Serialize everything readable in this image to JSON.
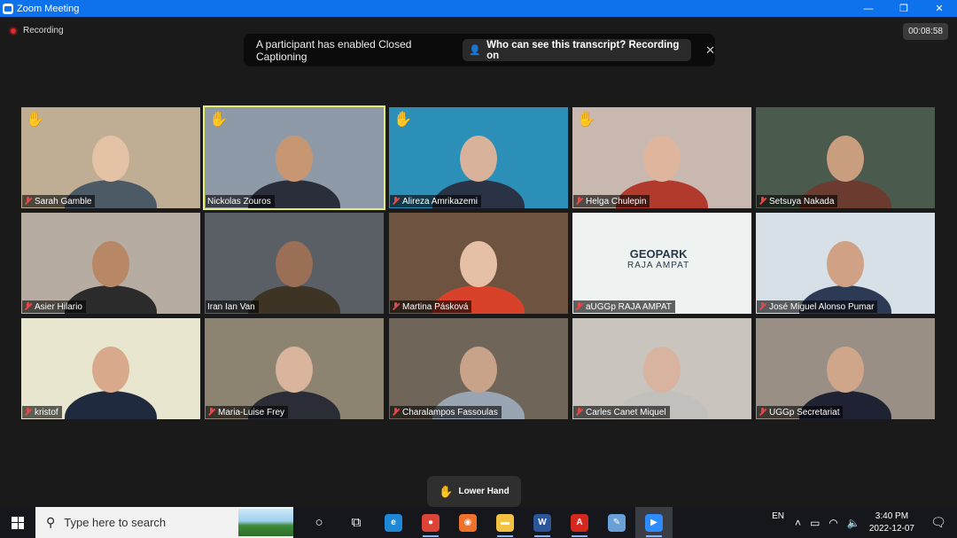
{
  "window": {
    "title": "Zoom Meeting",
    "minimize": "—",
    "maximize": "❐",
    "close": "✕"
  },
  "recording": {
    "label": "Recording"
  },
  "timer": "00:08:58",
  "caption_banner": {
    "message": "A participant has enabled Closed Captioning",
    "who_label": "Who can see this transcript? Recording on",
    "close": "✕"
  },
  "participants": [
    {
      "name": "Sarah Gamble",
      "muted": true,
      "hand_raised": true,
      "active": false,
      "bg": "#bfae93",
      "face": "#e3c2a6",
      "shirt": "#4c5a66"
    },
    {
      "name": "Nickolas Zouros",
      "muted": false,
      "hand_raised": true,
      "active": true,
      "bg": "#8f9aa8",
      "face": "#c79774",
      "shirt": "#2a2e3a"
    },
    {
      "name": "Alireza Amrikazemi",
      "muted": true,
      "hand_raised": true,
      "active": false,
      "bg": "#2b8fb8",
      "face": "#d8b29a",
      "shirt": "#2a3346"
    },
    {
      "name": "Helga Chulepin",
      "muted": true,
      "hand_raised": true,
      "active": false,
      "bg": "#c8b8b0",
      "face": "#e0b59d",
      "shirt": "#b23a2c"
    },
    {
      "name": "Setsuya Nakada",
      "muted": true,
      "hand_raised": false,
      "active": false,
      "bg": "#4a5a4c",
      "face": "#c99e7e",
      "shirt": "#6a3b2e"
    },
    {
      "name": "Asier Hilario",
      "muted": true,
      "hand_raised": false,
      "active": false,
      "bg": "#b7aca2",
      "face": "#b88766",
      "shirt": "#2b2b2b"
    },
    {
      "name": "Iran Ian Van",
      "muted": false,
      "hand_raised": false,
      "active": false,
      "bg": "#5a5f66",
      "face": "#9a6f55",
      "shirt": "#3e3426"
    },
    {
      "name": "Martina Pásková",
      "muted": true,
      "hand_raised": false,
      "active": false,
      "bg": "#6e5440",
      "face": "#e6bfa7",
      "shirt": "#d8422a"
    },
    {
      "name": "aUGGp RAJA AMPAT",
      "muted": true,
      "hand_raised": false,
      "active": false,
      "bg": "#eef3f1",
      "face": "",
      "shirt": ""
    },
    {
      "name": "José Miguel Alonso Pumar",
      "muted": true,
      "hand_raised": false,
      "active": false,
      "bg": "#d7e0e6",
      "face": "#d0a184",
      "shirt": "#2d3a55"
    },
    {
      "name": "kristof",
      "muted": true,
      "hand_raised": false,
      "active": false,
      "bg": "#e9e6cf",
      "face": "#d8a98a",
      "shirt": "#1f2a3e"
    },
    {
      "name": "Maria-Luise Frey",
      "muted": true,
      "hand_raised": false,
      "active": false,
      "bg": "#8c8370",
      "face": "#d9b49c",
      "shirt": "#2a2d36"
    },
    {
      "name": "Charalampos Fassoulas",
      "muted": true,
      "hand_raised": false,
      "active": false,
      "bg": "#6f6558",
      "face": "#c9a389",
      "shirt": "#9aa5b3"
    },
    {
      "name": "Carles Canet Miquel",
      "muted": true,
      "hand_raised": false,
      "active": false,
      "bg": "#c9c4bd",
      "face": "#d8b3a0",
      "shirt": "#c2c0bc"
    },
    {
      "name": "UGGp Secretariat",
      "muted": true,
      "hand_raised": false,
      "active": false,
      "bg": "#9a8f84",
      "face": "#cfa68a",
      "shirt": "#1f2233"
    }
  ],
  "geopark_slide": {
    "line1": "GEOPARK",
    "line2": "RAJA AMPAT"
  },
  "lower_hand": {
    "label": "Lower Hand"
  },
  "taskbar": {
    "search_placeholder": "Type here to search",
    "apps": [
      {
        "id": "cortana",
        "glyph": "○",
        "color": "",
        "running": false,
        "focused": false
      },
      {
        "id": "task-view",
        "glyph": "⧉",
        "color": "",
        "running": false,
        "focused": false
      },
      {
        "id": "edge",
        "glyph": "e",
        "color": "#1e88d6",
        "running": false,
        "focused": false
      },
      {
        "id": "chrome",
        "glyph": "●",
        "color": "#db4437",
        "running": true,
        "focused": false
      },
      {
        "id": "firefox",
        "glyph": "◉",
        "color": "#f0712b",
        "running": false,
        "focused": false
      },
      {
        "id": "file-explorer",
        "glyph": "▬",
        "color": "#f3c242",
        "running": true,
        "focused": false
      },
      {
        "id": "word",
        "glyph": "W",
        "color": "#2b579a",
        "running": true,
        "focused": false
      },
      {
        "id": "acrobat",
        "glyph": "A",
        "color": "#d5281e",
        "running": true,
        "focused": false
      },
      {
        "id": "paint",
        "glyph": "✎",
        "color": "#6aa0d8",
        "running": false,
        "focused": false
      },
      {
        "id": "zoom",
        "glyph": "▶",
        "color": "#2d8cff",
        "running": true,
        "focused": true
      }
    ],
    "language": "EN",
    "time": "3:40 PM",
    "date": "2022-12-07"
  }
}
